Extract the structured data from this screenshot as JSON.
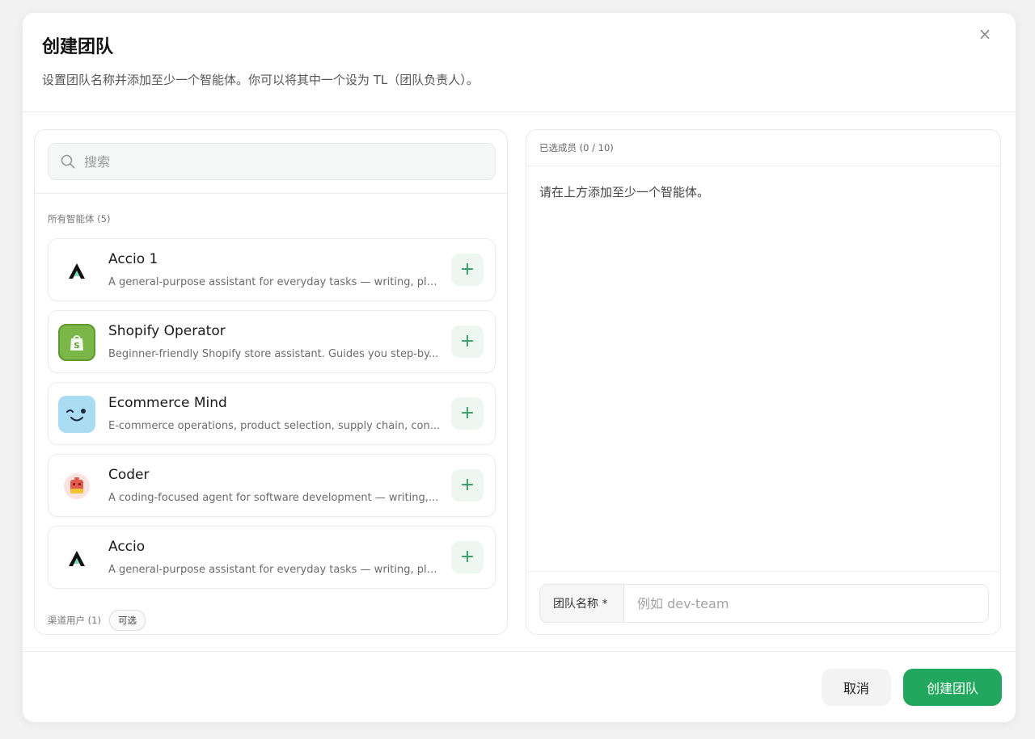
{
  "dialog": {
    "title": "创建团队",
    "subtitle": "设置团队名称并添加至少一个智能体。你可以将其中一个设为 TL（团队负责人）。",
    "close_label": "×"
  },
  "left": {
    "search": {
      "placeholder": "搜索",
      "value": ""
    },
    "section_label": "所有智能体 (5)",
    "agents": [
      {
        "name": "Accio 1",
        "desc": "A general-purpose assistant for everyday tasks — writing, pla...",
        "icon": "accio-logo-icon"
      },
      {
        "name": "Shopify Operator",
        "desc": "Beginner-friendly Shopify store assistant. Guides you step-by...",
        "icon": "shopify-bag-icon"
      },
      {
        "name": "Ecommerce Mind",
        "desc": "E-commerce operations, product selection, supply chain, con...",
        "icon": "wink-face-icon"
      },
      {
        "name": "Coder",
        "desc": "A coding-focused agent for software development — writing,...",
        "icon": "robot-face-icon"
      },
      {
        "name": "Accio",
        "desc": "A general-purpose assistant for everyday tasks — writing, pla...",
        "icon": "accio-logo-icon"
      }
    ],
    "add_label": "+",
    "channel_label": "渠道用户 (1)",
    "optional_badge": "可选"
  },
  "right": {
    "selected_header": "已选成员 (0 / 10)",
    "empty_hint": "请在上方添加至少一个智能体。",
    "team_name_label": "团队名称 *",
    "team_name_placeholder": "例如 dev-team",
    "team_name_value": ""
  },
  "footer": {
    "cancel_label": "取消",
    "create_label": "创建团队"
  },
  "colors": {
    "primary": "#22a75f",
    "add_button_bg": "#eef6f1",
    "shopify_green": "#7ab648",
    "ecommerce_blue": "#a9dcf3"
  }
}
